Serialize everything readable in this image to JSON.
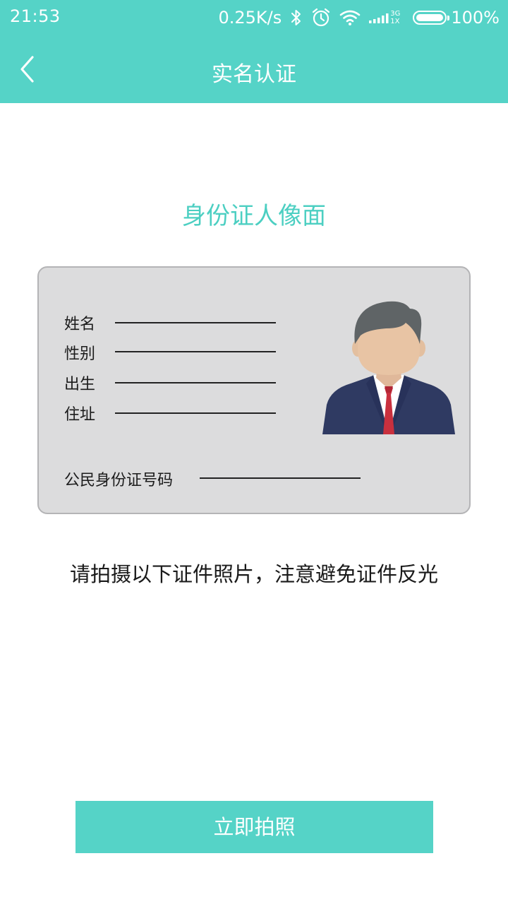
{
  "status_bar": {
    "time": "21:53",
    "network_speed": "0.25K/s",
    "network_type_top": "3G",
    "network_type_bottom": "1X",
    "battery_level": 1.0,
    "battery_text": "100%"
  },
  "app_bar": {
    "back_icon": "chevron-left-icon",
    "title": "实名认证"
  },
  "main": {
    "section_title": "身份证人像面",
    "card": {
      "fields": {
        "name": "姓名",
        "gender": "性别",
        "birth": "出生",
        "address": "住址",
        "id_number": "公民身份证号码"
      },
      "avatar_icon": "person-avatar-icon"
    },
    "instruction": "请拍摄以下证件照片，注意避免证件反光"
  },
  "footer": {
    "capture_button_label": "立即拍照"
  },
  "colors": {
    "accent": "#55d3c7",
    "section_title": "#4ccfc2",
    "card_background": "#dcdcdd",
    "card_border": "#b4b4b6",
    "text_dark": "#1a1a1a"
  }
}
